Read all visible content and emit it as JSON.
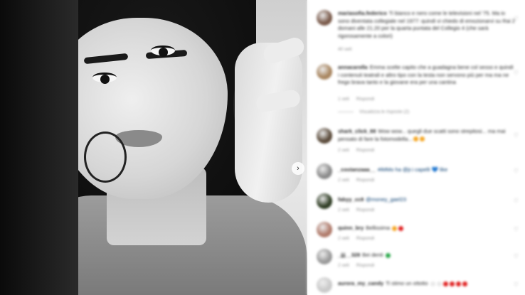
{
  "photo": {
    "alt": "",
    "nav_next": "›"
  },
  "comments": [
    {
      "username": "mariasofia.federico",
      "text": "Ti bianco e nero come le televisioni nel '75. Ma io sono diventata collegiale nel 1977: quindi vi chiedo di emozionarvi su Rai 2 domani alle 21.20 per la quarta puntata del Collegio 4 (che sarà rigorosamente a colori)",
      "time": "40 sett",
      "avatar_color": "#7a5a4a"
    },
    {
      "username": "annacarolla",
      "text": "Emma scelte capito che a guadagna bene col sesso e quindi i contenuti teatrali e altro tipo con la testa non servono più per ma ma ne frego brava tanto e la giovane era per una cantina",
      "time": "1 sett",
      "reply": "Rispondi",
      "view_replies": "Visualizza le risposte (2)",
      "avatar_color": "#a8855f"
    },
    {
      "username": "shark_click_88",
      "text": "Wow wow... quegli due scatti sono strepitosi... ma mai pensato di fare la fotomodella...",
      "time": "2 sett",
      "reply": "Rispondi",
      "emoji_colors": [
        "#f5a623",
        "#f5a623"
      ],
      "avatar_color": "#5a4a3a"
    },
    {
      "username": "_costanzaaa__",
      "text": "#iMMo ha @jr.i capelli 💙 like",
      "time": "2 sett",
      "reply": "Rispondi",
      "avatar_color": "#8a8a8a"
    },
    {
      "username": "fabyy_cc8",
      "text": "@money_gael23",
      "time": "2 sett",
      "reply": "Rispondi",
      "avatar_color": "#2f3d24"
    },
    {
      "username": "quinn_bry",
      "text": "Bellissima",
      "time": "2 sett",
      "reply": "Rispondi",
      "emoji_colors": [
        "#f5a623",
        "#e02020"
      ],
      "avatar_color": "#b07a6a"
    },
    {
      "username": "_jjj__328",
      "text": "Bei denti",
      "time": "2 sett",
      "reply": "Rispondi",
      "emoji_colors": [
        "#2aa84a"
      ],
      "avatar_color": "#9a9a9a"
    },
    {
      "username": "aurora_my_candy",
      "text": "Ti stimo un ottotto",
      "time": "2 sett",
      "reply": "Rispondi",
      "emoji_colors": [
        "#e8e8e8",
        "#e8e8e8",
        "#e02020",
        "#e02020",
        "#e02020",
        "#e02020"
      ],
      "avatar_color": "#c9c9c9"
    }
  ]
}
